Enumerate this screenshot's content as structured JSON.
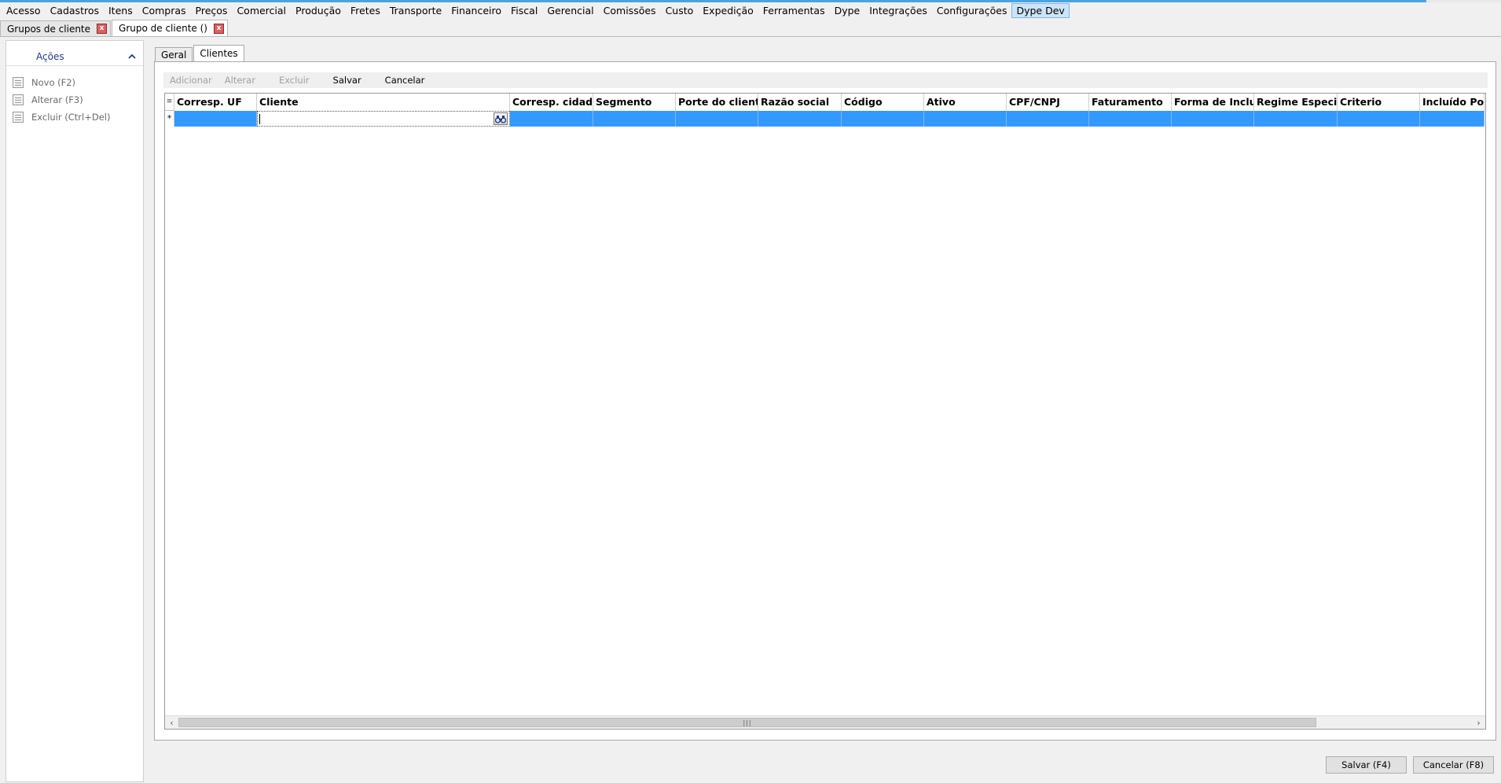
{
  "menu": [
    "Acesso",
    "Cadastros",
    "Itens",
    "Compras",
    "Preços",
    "Comercial",
    "Produção",
    "Fretes",
    "Transporte",
    "Financeiro",
    "Fiscal",
    "Gerencial",
    "Comissões",
    "Custo",
    "Expedição",
    "Ferramentas",
    "Dype",
    "Integrações",
    "Configurações",
    "Dype Dev"
  ],
  "doc_tabs": [
    {
      "label": "Grupos de cliente",
      "close": "x"
    },
    {
      "label": "Grupo de cliente ()",
      "close": "x"
    }
  ],
  "side_panel": {
    "title": "Ações",
    "actions": [
      {
        "label": "Novo (F2)"
      },
      {
        "label": "Alterar (F3)"
      },
      {
        "label": "Excluir (Ctrl+Del)"
      }
    ]
  },
  "inner_tabs": [
    "Geral",
    "Clientes"
  ],
  "toolbar": {
    "adicionar": "Adicionar",
    "alterar": "Alterar",
    "excluir": "Excluir",
    "salvar": "Salvar",
    "cancelar": "Cancelar"
  },
  "grid": {
    "columns": [
      "Corresp. UF",
      "Cliente",
      "Corresp. cidade",
      "Segmento",
      "Porte do cliente",
      "Razão social",
      "Código",
      "Ativo",
      "CPF/CNPJ",
      "Faturamento",
      "Forma de Inclus",
      "Regime Especia",
      "Criterio",
      "Incluído Por"
    ],
    "new_row_marker": "*",
    "selector_header": "≡"
  },
  "footer": {
    "save_label": "Salvar (F4)",
    "cancel_label": "Cancelar (F8)"
  }
}
